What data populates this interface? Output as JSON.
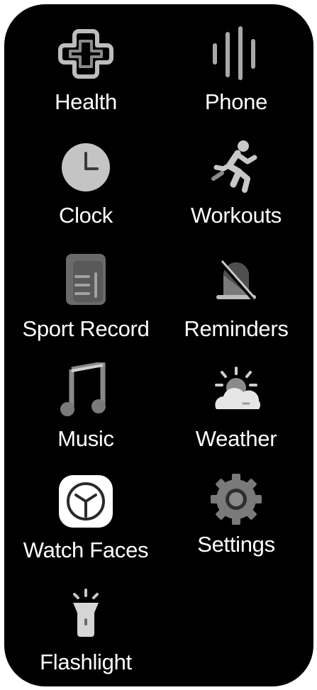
{
  "apps": {
    "health": {
      "label": "Health",
      "icon": "health-cross-icon"
    },
    "phone": {
      "label": "Phone",
      "icon": "phone-soundwave-icon"
    },
    "clock": {
      "label": "Clock",
      "icon": "clock-icon"
    },
    "workouts": {
      "label": "Workouts",
      "icon": "running-person-icon"
    },
    "sport_record": {
      "label": "Sport Record",
      "icon": "document-record-icon"
    },
    "reminders": {
      "label": "Reminders",
      "icon": "bell-off-icon"
    },
    "music": {
      "label": "Music",
      "icon": "music-note-icon"
    },
    "weather": {
      "label": "Weather",
      "icon": "sun-cloud-icon"
    },
    "watch_faces": {
      "label": "Watch Faces",
      "icon": "watch-face-icon"
    },
    "settings": {
      "label": "Settings",
      "icon": "gear-icon"
    },
    "flashlight": {
      "label": "Flashlight",
      "icon": "flashlight-icon"
    }
  }
}
